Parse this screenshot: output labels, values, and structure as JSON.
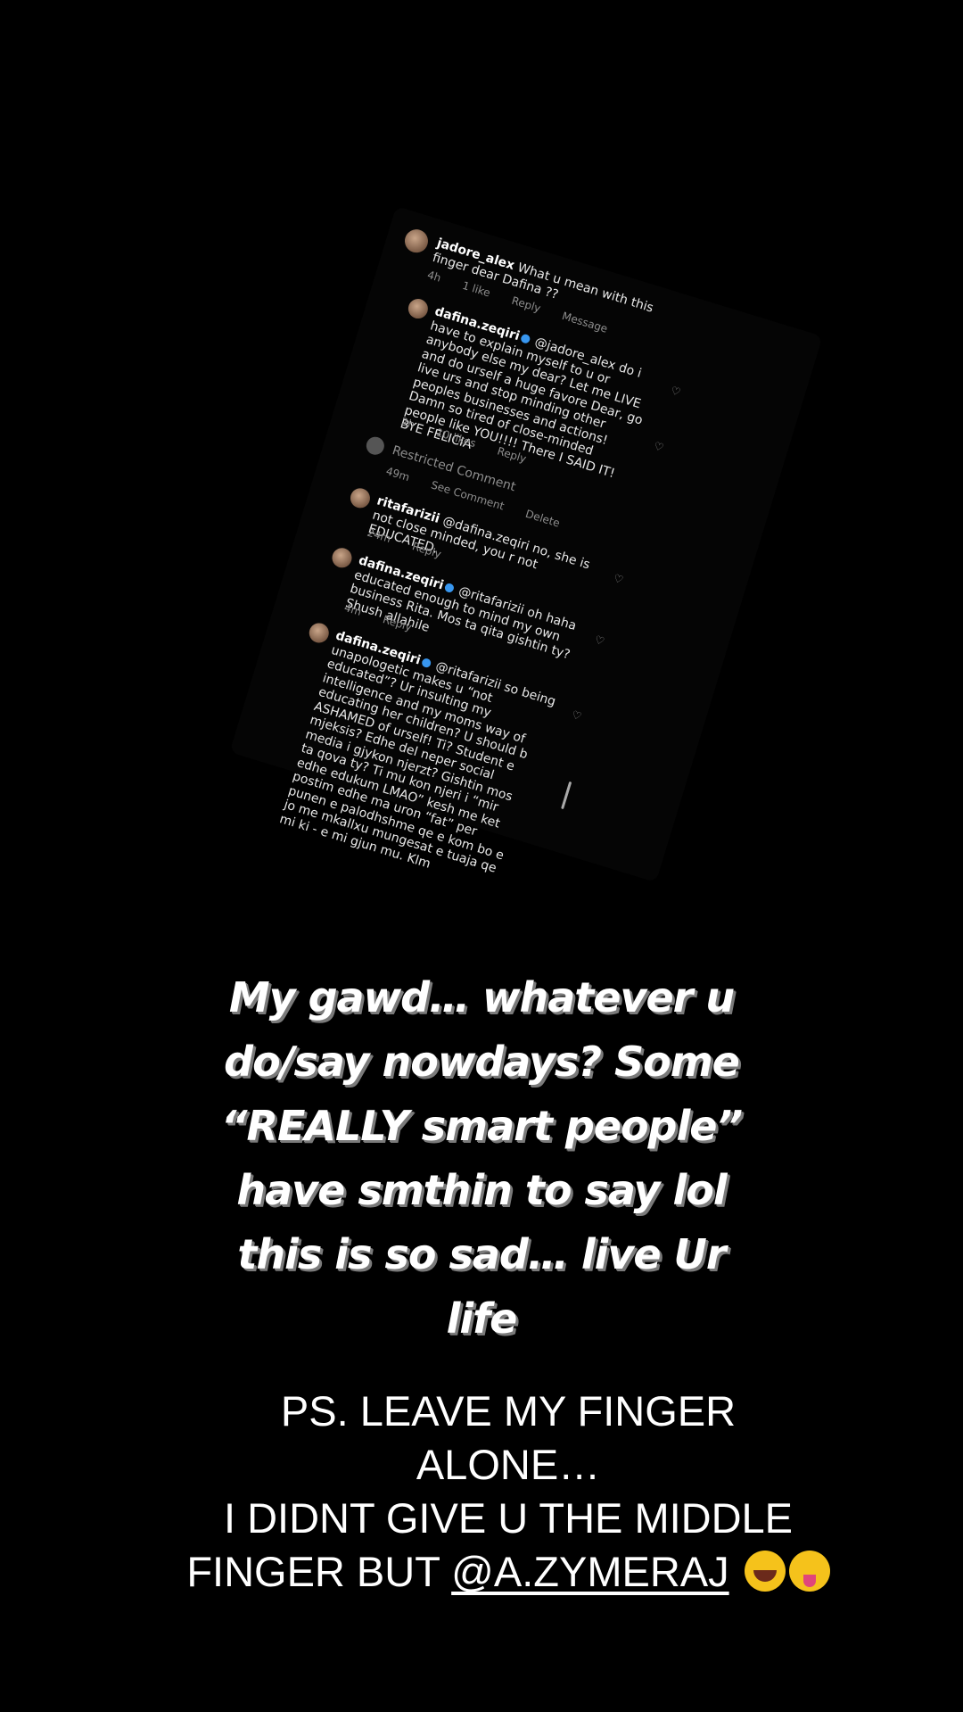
{
  "comments": [
    {
      "username": "jadore_alex",
      "text": "What u mean with this finger dear Dafina ??",
      "time": "4h",
      "likes": "1 like",
      "reply": "Reply",
      "message": "Message"
    },
    {
      "username": "dafina.zeqiri",
      "text": "@jadore_alex do i have to explain myself to u or anybody else my dear? Let me LIVE and do urself a huge favore Dear, go live urs and stop minding other peoples businesses and actions! Damn so tired of close-minded people like YOU!!!! There I SAID IT! BYE FELICIA",
      "time": "2h",
      "likes": "10 likes",
      "reply": "Reply"
    },
    {
      "restricted": "Restricted Comment",
      "time": "49m",
      "see": "See Comment",
      "delete": "Delete"
    },
    {
      "username": "ritafarizii",
      "text": "@dafina.zeqiri no, she is not close minded, you r not EDUCATED.",
      "time": "24m",
      "reply": "Reply"
    },
    {
      "username": "dafina.zeqiri",
      "text": "@ritafarizii oh haha educated enough to mind my own business Rita. Mos ta qita gishtin ty? Shush allahile",
      "time": "4m",
      "reply": "Reply"
    },
    {
      "username": "dafina.zeqiri",
      "text": "@ritafarizii so being unapologetic makes u “not educated”? Ur insulting my intelligence and my moms way of educating her children? U should b ASHAMED of urself! Ti? Student e mjeksis? Edhe del neper social media i gjykon njerzt? Gishtin mos ta qova ty? Ti mu kon njeri i “mir edhe edukum LMAO” kesh me ket postim edhe ma uron “fat” per punen e palodhshme qe e kom bo e jo me mkallxu mungesat e tuaja qe mi ki - e mi gjun mu. Klm"
    }
  ],
  "caption": {
    "line1": "My gawd… whatever u",
    "line2": "do/say nowdays? Some",
    "line3": "“REALLY smart people”",
    "line4": "have smthin to say lol",
    "line5": "this is so sad… live Ur",
    "line6": "life"
  },
  "ps": {
    "line1": "PS. LEAVE MY FINGER",
    "line2": "ALONE…",
    "line3": "I DIDNT GIVE U THE MIDDLE",
    "line4_prefix": "FINGER BUT ",
    "mention": "@A.ZYMERAJ"
  },
  "icons": [
    "heart-icon",
    "verified-badge-icon",
    "laughing-emoji-icon",
    "tongue-emoji-icon"
  ]
}
